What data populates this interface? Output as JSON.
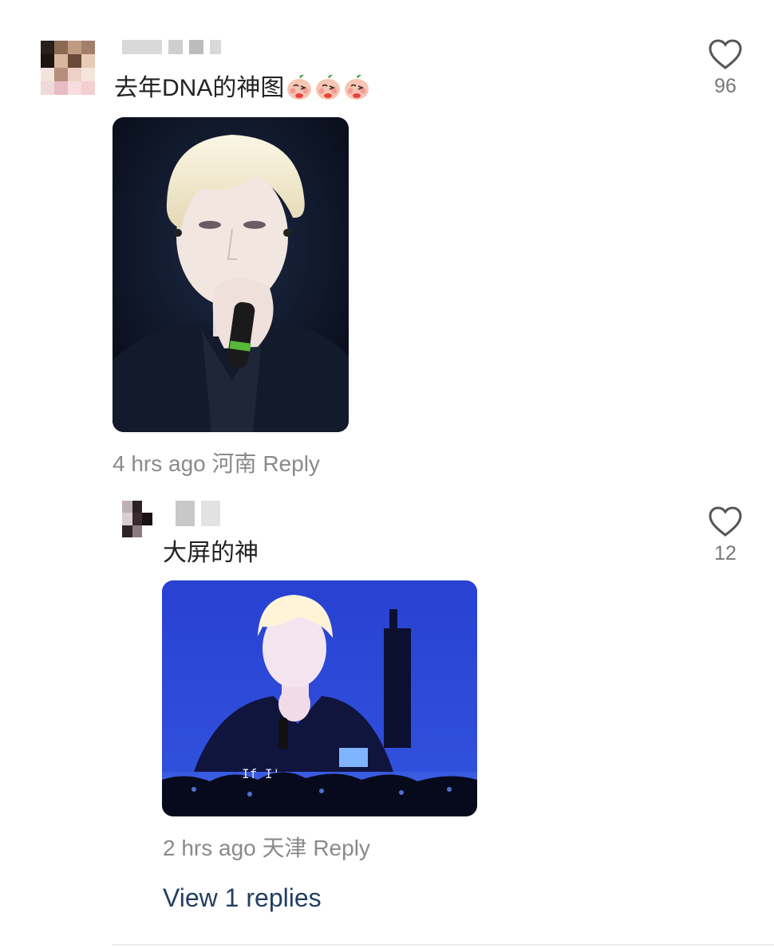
{
  "comments": [
    {
      "text": "去年DNA的神图",
      "emoji": "blush-tomato-emoji",
      "emoji_count": 3,
      "time": "4 hrs ago",
      "location": "河南",
      "reply_label": "Reply",
      "likes": "96"
    },
    {
      "text": "大屏的神",
      "time": "2 hrs ago",
      "location": "天津",
      "reply_label": "Reply",
      "likes": "12",
      "photo_caption": "If I'"
    }
  ],
  "view_replies_label": "View 1 replies",
  "icons": {
    "like": "heart-outline-icon"
  },
  "colors": {
    "link": "#233f62",
    "meta": "#8a8a8a",
    "stage_blue": "#2c3fd0"
  }
}
